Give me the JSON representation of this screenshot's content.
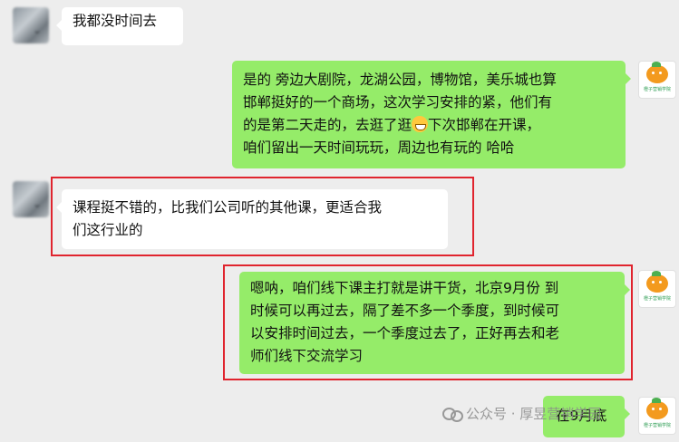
{
  "messages": [
    {
      "id": "m0",
      "side": "left",
      "lines": [
        "我都没时间去"
      ]
    },
    {
      "id": "m1",
      "side": "right",
      "lines": [
        "是的 旁边大剧院，龙湖公园，博物馆，美乐城也算",
        "邯郸挺好的一个商场，这次学习安排的紧，他们有",
        "的是第二天走的，去逛了逛",
        "下次邯郸在开课，",
        "咱们留出一天时间玩玩，周边也有玩的 哈哈"
      ]
    },
    {
      "id": "m2",
      "side": "left",
      "lines": [
        "课程挺不错的，比我们公司听的其他课，更适合我",
        "们这行业的"
      ]
    },
    {
      "id": "m3",
      "side": "right",
      "lines": [
        "嗯呐，咱们线下课主打就是讲干货，北京9月份 到",
        "时候可以再过去，隔了差不多一个季度，到时候可",
        "以安排时间过去，一个季度过去了，正好再去和老",
        "师们线下交流学习"
      ]
    },
    {
      "id": "m4",
      "side": "right",
      "lines": [
        "在9月底"
      ]
    }
  ],
  "avatars": {
    "left_mark": "⌄",
    "right_brand": "橙子营销学院"
  },
  "watermark": {
    "text": "公众号 · 厚昱营销学园"
  },
  "colors": {
    "green_bubble": "#95ec69",
    "white_bubble": "#ffffff",
    "highlight": "#e0242e",
    "background": "#ededed"
  }
}
